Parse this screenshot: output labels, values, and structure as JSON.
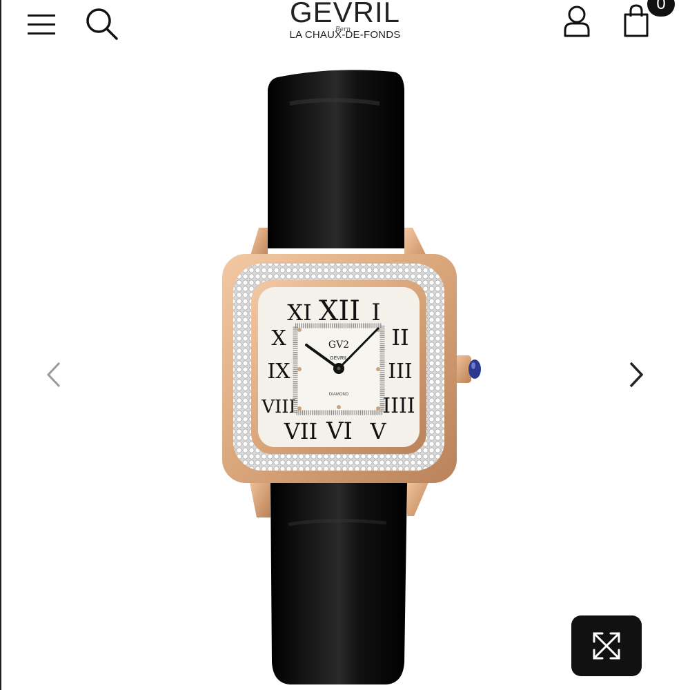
{
  "header": {
    "brand_name": "GEVRIL",
    "brand_script": "Bern",
    "brand_location": "LA CHAUX-DE-FONDS",
    "cart_count": "0",
    "icons": {
      "menu": "hamburger-menu-icon",
      "search": "search-icon",
      "account": "user-icon",
      "cart": "shopping-bag-icon"
    }
  },
  "product_image": {
    "dial_brand": "GEVRIL",
    "dial_label": "DIAMOND",
    "numerals": [
      "XII",
      "I",
      "II",
      "III",
      "IIII",
      "V",
      "VI",
      "VII",
      "VIII",
      "IX",
      "X",
      "XI"
    ],
    "colors": {
      "strap": "#0a0a0a",
      "case": "#d9a57a",
      "dial": "#f4f1ea",
      "crown_stone": "#2b3a8f"
    }
  },
  "carousel": {
    "prev_icon": "chevron-left-icon",
    "next_icon": "chevron-right-icon",
    "fullscreen_icon": "expand-arrows-icon"
  }
}
